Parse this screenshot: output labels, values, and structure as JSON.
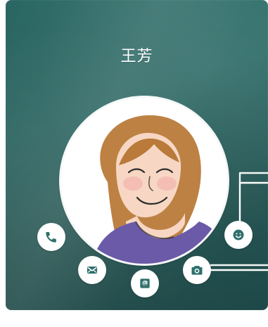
{
  "contact": {
    "name": "王芳"
  },
  "actions": [
    {
      "id": "call",
      "icon": "phone-icon"
    },
    {
      "id": "message",
      "icon": "message-icon"
    },
    {
      "id": "email",
      "icon": "email-icon"
    },
    {
      "id": "camera",
      "icon": "camera-icon"
    },
    {
      "id": "emoji",
      "icon": "smiley-icon"
    }
  ],
  "colors": {
    "background": "#2b6a66",
    "icon": "#2f6f6b",
    "shirt": "#6b5aa8",
    "hair": "#b97a3a"
  }
}
